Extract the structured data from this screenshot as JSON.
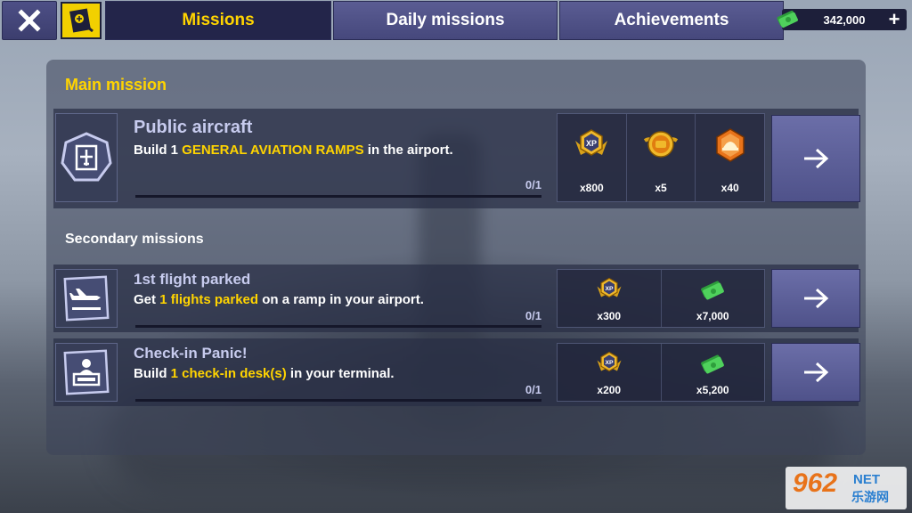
{
  "tabs": {
    "missions": "Missions",
    "daily": "Daily missions",
    "achievements": "Achievements"
  },
  "currency": {
    "amount": "342,000",
    "icon": "cash-icon"
  },
  "colors": {
    "accent": "#ffd400",
    "tab_bg": "#4f518a",
    "active_tab_bg": "#23254a"
  },
  "main": {
    "title": "Main mission",
    "mission": {
      "name": "Public aircraft",
      "desc_pre": "Build 1 ",
      "desc_hl": "GENERAL AVIATION RAMPS",
      "desc_post": " in the airport.",
      "progress": "0/1",
      "progress_fraction": 0,
      "rewards": [
        {
          "icon": "xp-badge-icon",
          "qty": "x800"
        },
        {
          "icon": "gold-medal-icon",
          "qty": "x5"
        },
        {
          "icon": "worker-helmet-icon",
          "qty": "x40"
        }
      ]
    }
  },
  "secondary": {
    "title": "Secondary missions",
    "missions": [
      {
        "name": "1st flight parked",
        "desc_pre": "Get ",
        "desc_hl": "1 flights parked",
        "desc_post": " on a ramp in your airport.",
        "progress": "0/1",
        "progress_fraction": 0,
        "rewards": [
          {
            "icon": "xp-badge-icon",
            "qty": "x300"
          },
          {
            "icon": "cash-icon",
            "qty": "x7,000"
          }
        ]
      },
      {
        "name": "Check-in Panic!",
        "desc_pre": "Build ",
        "desc_hl": "1 check-in desk(s)",
        "desc_post": " in your terminal.",
        "progress": "0/1",
        "progress_fraction": 0,
        "rewards": [
          {
            "icon": "xp-badge-icon",
            "qty": "x200"
          },
          {
            "icon": "cash-icon",
            "qty": "x5,200"
          }
        ]
      }
    ]
  },
  "watermark": {
    "number": "962",
    "net": "NET",
    "cn": "乐游网"
  }
}
